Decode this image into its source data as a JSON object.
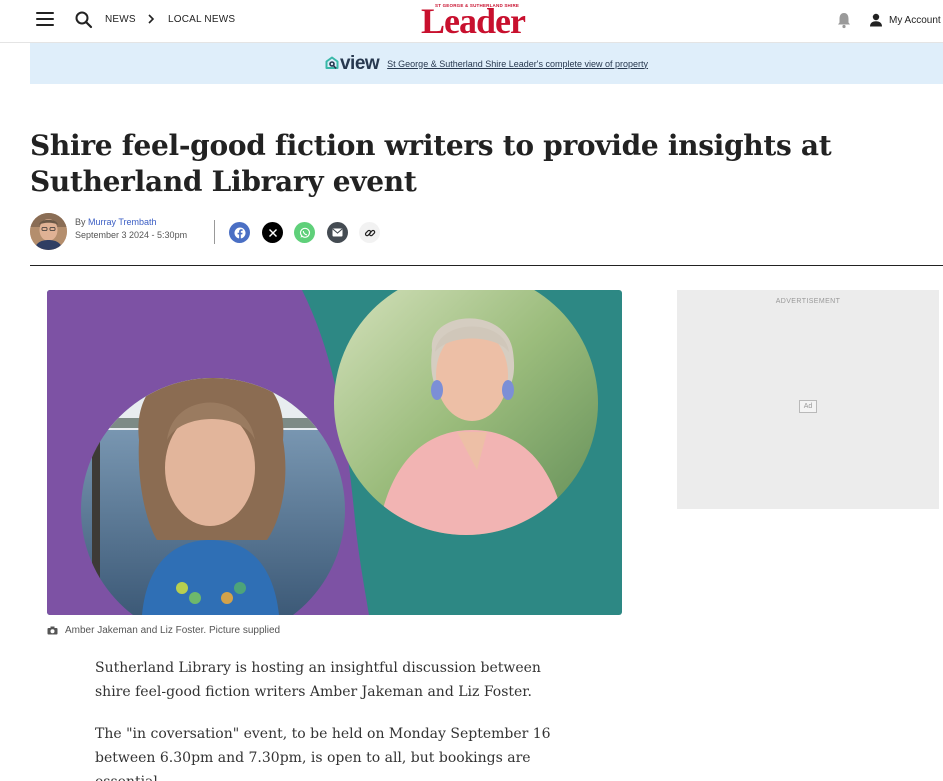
{
  "header": {
    "breadcrumb": [
      "NEWS",
      "LOCAL NEWS"
    ],
    "logo": {
      "small_text": "ST GEORGE & SUTHERLAND SHIRE",
      "main_text": "Leader",
      "color": "#c8102e"
    },
    "account_label": "My Account"
  },
  "banner": {
    "logo_text": "view",
    "link_text": "St George & Sutherland Shire Leader's complete view of property"
  },
  "article": {
    "headline": "Shire feel-good fiction writers to provide insights at Sutherland Library event",
    "byline_prefix": "By",
    "author": "Murray Trembath",
    "date": "September 3 2024 - 5:30pm",
    "share_buttons": [
      {
        "name": "facebook",
        "icon": "facebook-icon",
        "color": "#4a6fc4"
      },
      {
        "name": "x",
        "icon": "x-icon",
        "color": "#000000"
      },
      {
        "name": "whatsapp",
        "icon": "whatsapp-icon",
        "color": "#5fd07a"
      },
      {
        "name": "email",
        "icon": "email-icon",
        "color": "#444b52"
      },
      {
        "name": "copy-link",
        "icon": "link-icon",
        "color": "#f2f2f2"
      }
    ],
    "caption": "Amber Jakeman and Liz Foster. Picture supplied",
    "paragraphs": [
      "Sutherland Library is hosting an insightful discussion between shire feel-good fiction writers Amber Jakeman and Liz Foster.",
      "The \"in coversation\" event, to be held on Monday September 16 between 6.30pm and 7.30pm, is open to all, but bookings are essential."
    ]
  },
  "ad": {
    "label": "ADVERTISEMENT",
    "badge": "Ad"
  },
  "colors": {
    "banner_bg": "#dfeefa",
    "hero_purple": "#7d52a4",
    "hero_teal": "#2d8884"
  }
}
